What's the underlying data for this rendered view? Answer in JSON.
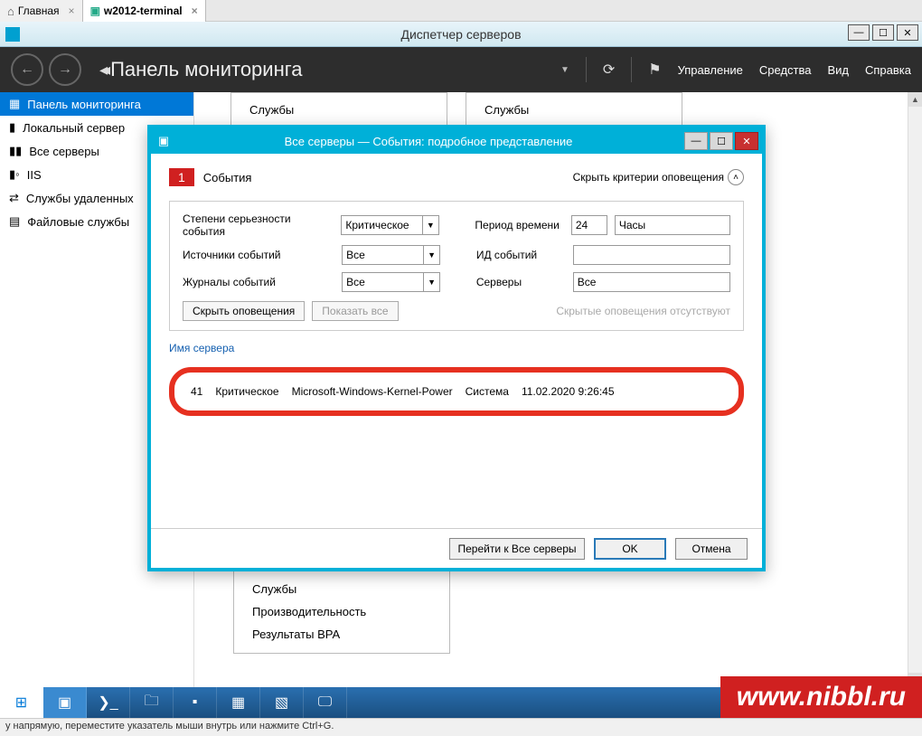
{
  "browser_tabs": {
    "home": "Главная",
    "terminal": "w2012-terminal"
  },
  "window": {
    "title": "Диспетчер серверов"
  },
  "header": {
    "title": "Панель мониторинга",
    "links": {
      "manage": "Управление",
      "tools": "Средства",
      "view": "Вид",
      "help": "Справка"
    }
  },
  "sidebar": {
    "items": [
      {
        "label": "Панель мониторинга"
      },
      {
        "label": "Локальный сервер"
      },
      {
        "label": "Все серверы"
      },
      {
        "label": "IIS"
      },
      {
        "label": "Службы удаленных"
      },
      {
        "label": "Файловые службы"
      }
    ]
  },
  "bg_panels": {
    "left": {
      "line1": "Службы"
    },
    "right": {
      "line1": "Службы"
    }
  },
  "behind_lower": {
    "line1": "Службы",
    "line2": "Производительность",
    "line3": "Результаты BPA"
  },
  "dialog": {
    "title": "Все серверы — События: подробное представление",
    "badge": "1",
    "badge_label": "События",
    "hide_criteria": "Скрыть критерии оповещения",
    "filters": {
      "severity_label": "Степени серьезности события",
      "severity_value": "Критическое",
      "period_label": "Период времени",
      "period_value": "24",
      "period_unit": "Часы",
      "sources_label": "Источники событий",
      "sources_value": "Все",
      "eventid_label": "ИД событий",
      "eventid_value": "",
      "logs_label": "Журналы событий",
      "logs_value": "Все",
      "servers_label": "Серверы",
      "servers_value": "Все"
    },
    "actions": {
      "hide_alerts": "Скрыть оповещения",
      "show_all": "Показать все",
      "no_hidden": "Скрытые оповещения отсутствуют"
    },
    "cols": {
      "server": "Имя сервера"
    },
    "event": {
      "id": "41",
      "severity": "Критическое",
      "source": "Microsoft-Windows-Kernel-Power",
      "log": "Система",
      "time": "11.02.2020 9:26:45"
    },
    "footer": {
      "goto": "Перейти к Все серверы",
      "ok": "OK",
      "cancel": "Отмена"
    }
  },
  "statusbar": "у напрямую, переместите указатель мыши внутрь или нажмите Ctrl+G.",
  "watermark": "www.nibbl.ru"
}
